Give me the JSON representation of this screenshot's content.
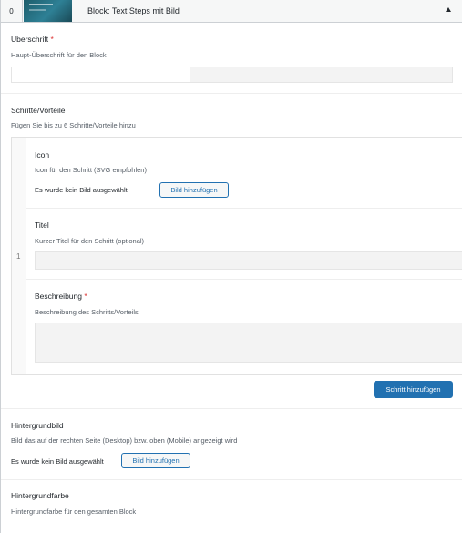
{
  "header": {
    "order_number": "0",
    "title": "Block: Text Steps mit Bild"
  },
  "fields": {
    "ueberschrift": {
      "label": "Überschrift",
      "required_mark": "*",
      "description": "Haupt-Überschrift für den Block",
      "value": ""
    },
    "schritte": {
      "label": "Schritte/Vorteile",
      "description": "Fügen Sie bis zu 6 Schritte/Vorteile hinzu",
      "row_index": "1",
      "icon": {
        "label": "Icon",
        "description": "Icon für den Schritt (SVG empfohlen)",
        "no_image_text": "Es wurde kein Bild ausgewählt",
        "button_label": "Bild hinzufügen"
      },
      "titel": {
        "label": "Titel",
        "description": "Kurzer Titel für den Schritt (optional)",
        "value": ""
      },
      "beschreibung": {
        "label": "Beschreibung",
        "required_mark": "*",
        "description": "Beschreibung des Schritts/Vorteils",
        "value": ""
      },
      "add_row_label": "Schritt hinzufügen"
    },
    "hintergrundbild": {
      "label": "Hintergrundbild",
      "description": "Bild das auf der rechten Seite (Desktop) bzw. oben (Mobile) angezeigt wird",
      "no_image_text": "Es wurde kein Bild ausgewählt",
      "button_label": "Bild hinzufügen"
    },
    "hintergrundfarbe": {
      "label": "Hintergrundfarbe",
      "description": "Hintergrundfarbe für den gesamten Block"
    }
  },
  "colors": {
    "accent": "#2271b1",
    "required": "#dc3232",
    "border": "#ccd0d4"
  }
}
